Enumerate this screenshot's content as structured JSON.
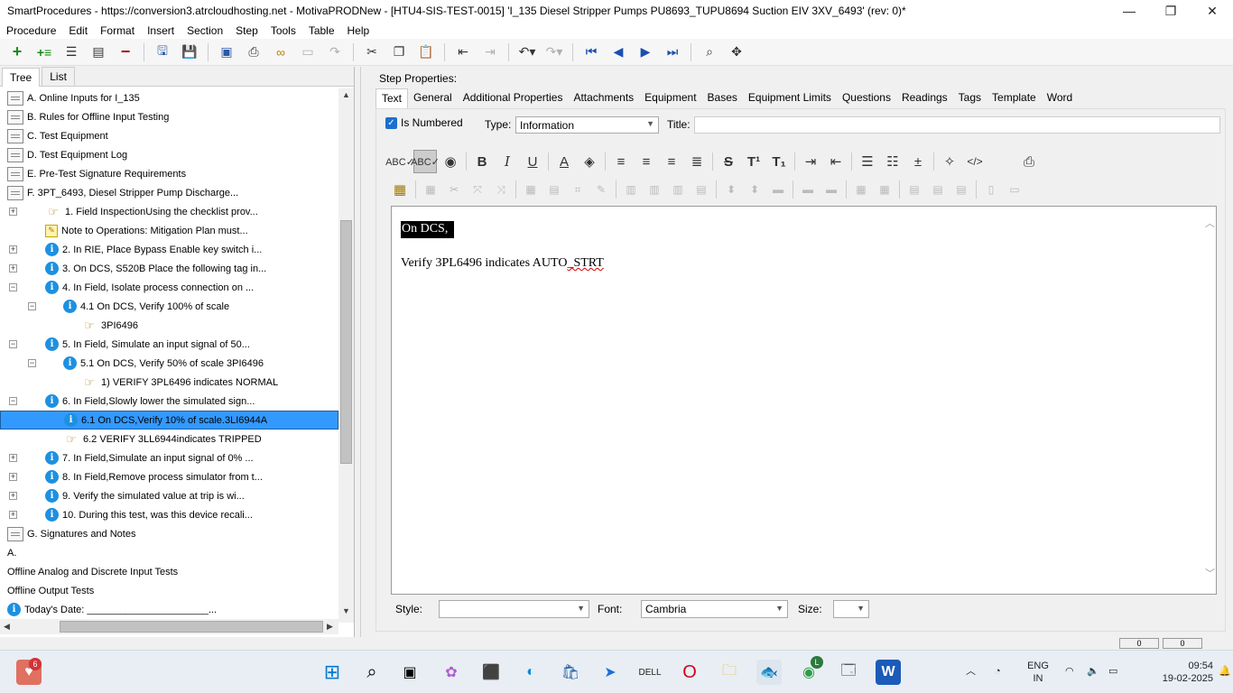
{
  "window": {
    "title": "SmartProcedures - https://conversion3.atrcloudhosting.net - MotivaPRODNew - [HTU4-SIS-TEST-0015] 'I_135 Diesel Stripper Pumps PU8693_TUPU8694 Suction EIV 3XV_6493' (rev: 0)*",
    "controls": [
      "minimize-icon",
      "maximize-icon",
      "close-icon"
    ]
  },
  "menu": [
    "Procedure",
    "Edit",
    "Format",
    "Insert",
    "Section",
    "Step",
    "Tools",
    "Table",
    "Help"
  ],
  "left_tabs": [
    "Tree",
    "List"
  ],
  "tree": [
    {
      "text": "A. Online Inputs for I_135",
      "icon": "doc",
      "indent": 0,
      "exp": ""
    },
    {
      "text": "B. Rules for Offline Input Testing",
      "icon": "doc",
      "indent": 0,
      "exp": ""
    },
    {
      "text": "C. Test Equipment",
      "icon": "doc",
      "indent": 0,
      "exp": ""
    },
    {
      "text": "D. Test Equipment Log",
      "icon": "doc",
      "indent": 0,
      "exp": ""
    },
    {
      "text": "E. Pre-Test Signature Requirements",
      "icon": "doc",
      "indent": 0,
      "exp": ""
    },
    {
      "text": "F. 3PT_6493, Diesel Stripper Pump Discharge...",
      "icon": "doc",
      "indent": 0,
      "exp": ""
    },
    {
      "text": "1. Field InspectionUsing the checklist prov...",
      "icon": "hand",
      "indent": 1,
      "exp": "+"
    },
    {
      "text": "Note to Operations: Mitigation Plan must...",
      "icon": "note",
      "indent": 1,
      "exp": ""
    },
    {
      "text": "2. In RIE, Place Bypass Enable key switch i...",
      "icon": "info",
      "indent": 1,
      "exp": "+"
    },
    {
      "text": "3. On DCS, S520B Place the following tag in...",
      "icon": "info",
      "indent": 1,
      "exp": "+"
    },
    {
      "text": "4. In Field, Isolate process connection on ...",
      "icon": "info",
      "indent": 1,
      "exp": "-"
    },
    {
      "text": "4.1 On DCS, Verify 100% of scale",
      "icon": "info",
      "indent": 2,
      "exp": "-"
    },
    {
      "text": "3PI6496",
      "icon": "hand",
      "indent": 3,
      "exp": ""
    },
    {
      "text": "5. In Field, Simulate an input signal of 50...",
      "icon": "info",
      "indent": 1,
      "exp": "-"
    },
    {
      "text": "5.1 On DCS, Verify 50% of scale 3PI6496",
      "icon": "info",
      "indent": 2,
      "exp": "-"
    },
    {
      "text": "1) VERIFY 3PL6496 indicates NORMAL",
      "icon": "hand",
      "indent": 3,
      "exp": ""
    },
    {
      "text": "6. In Field,Slowly lower the simulated sign...",
      "icon": "info",
      "indent": 1,
      "exp": "-"
    },
    {
      "text": "6.1 On DCS,Verify 10% of scale.3LI6944A",
      "icon": "info",
      "indent": 2,
      "exp": "",
      "selected": true
    },
    {
      "text": "6.2 VERIFY 3LL6944indicates TRIPPED",
      "icon": "hand",
      "indent": 2,
      "exp": ""
    },
    {
      "text": "7. In Field,Simulate an input signal of 0% ...",
      "icon": "info",
      "indent": 1,
      "exp": "+"
    },
    {
      "text": "8. In Field,Remove process simulator from t...",
      "icon": "info",
      "indent": 1,
      "exp": "+"
    },
    {
      "text": "9. Verify the simulated value at trip is wi...",
      "icon": "info",
      "indent": 1,
      "exp": "+"
    },
    {
      "text": "10. During this test, was this device recali...",
      "icon": "info",
      "indent": 1,
      "exp": "+"
    },
    {
      "text": "G. Signatures and Notes",
      "icon": "doc",
      "indent": 0,
      "exp": ""
    },
    {
      "text": "A.",
      "icon": "none",
      "indent": 0,
      "exp": ""
    },
    {
      "text": "Offline Analog and Discrete Input Tests",
      "icon": "none",
      "indent": 0,
      "exp": ""
    },
    {
      "text": "Offline Output Tests",
      "icon": "none",
      "indent": 0,
      "exp": ""
    },
    {
      "text": "Today's Date: ______________________...",
      "icon": "info",
      "indent": 0,
      "exp": ""
    }
  ],
  "props": {
    "header": "Step Properties:",
    "tabs": [
      "Text",
      "General",
      "Additional Properties",
      "Attachments",
      "Equipment",
      "Bases",
      "Equipment Limits",
      "Questions",
      "Readings",
      "Tags",
      "Template",
      "Word"
    ],
    "is_numbered_label": "Is Numbered",
    "type_label": "Type:",
    "type_value": "Information",
    "title_label": "Title:",
    "title_value": ""
  },
  "editor": {
    "line1": "On DCS,",
    "line2_prefix": "Verify 3PL6496  indicates AUTO",
    "line2_squiggle": "_STRT"
  },
  "bottom": {
    "style_label": "Style:",
    "style_value": "",
    "font_label": "Font:",
    "font_value": "Cambria",
    "size_label": "Size:",
    "size_value": ""
  },
  "status": {
    "box1": "0",
    "box2": "0"
  },
  "taskbar": {
    "notification_count": "6",
    "chrome_badge": "L",
    "lang_line1": "ENG",
    "lang_line2": "IN",
    "time": "09:54",
    "date": "19-02-2025"
  }
}
